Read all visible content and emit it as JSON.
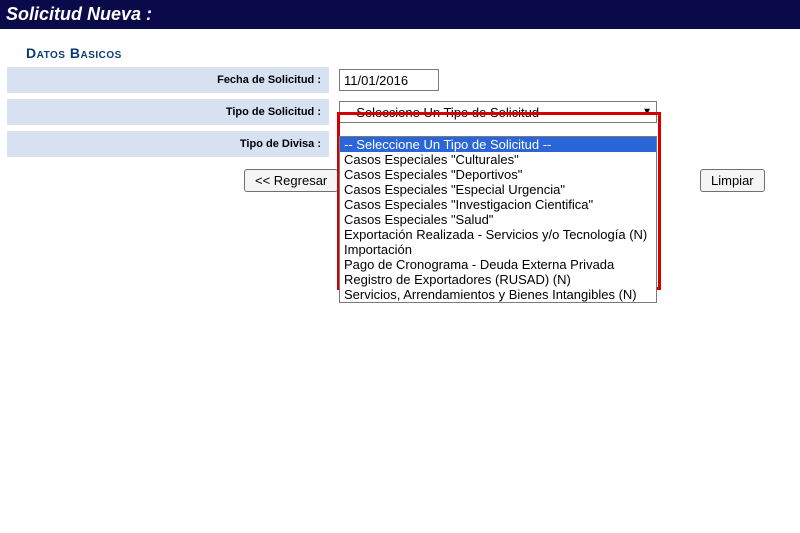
{
  "page_title": "Solicitud Nueva :",
  "section_heading": "Datos Basicos",
  "labels": {
    "fecha": "Fecha de Solicitud :",
    "tipo": "Tipo de Solicitud :",
    "divisa": "Tipo de Divisa :"
  },
  "fields": {
    "fecha_value": "11/01/2016",
    "tipo_selected": "-- Seleccione Un Tipo de Solicitud --"
  },
  "buttons": {
    "regresar": "<<  Regresar",
    "limpiar": "Limpiar"
  },
  "dropdown_options": [
    "-- Seleccione Un Tipo de Solicitud --",
    "Casos Especiales \"Culturales\"",
    "Casos Especiales \"Deportivos\"",
    "Casos Especiales \"Especial Urgencia\"",
    "Casos Especiales \"Investigacion Cientifica\"",
    "Casos Especiales \"Salud\"",
    "Exportación Realizada - Servicios y/o Tecnología (N)",
    "Importación",
    "Pago de Cronograma - Deuda Externa Privada",
    "Registro de Exportadores (RUSAD) (N)",
    "Servicios, Arrendamientos y Bienes Intangibles (N)"
  ],
  "highlighted_index": 0
}
